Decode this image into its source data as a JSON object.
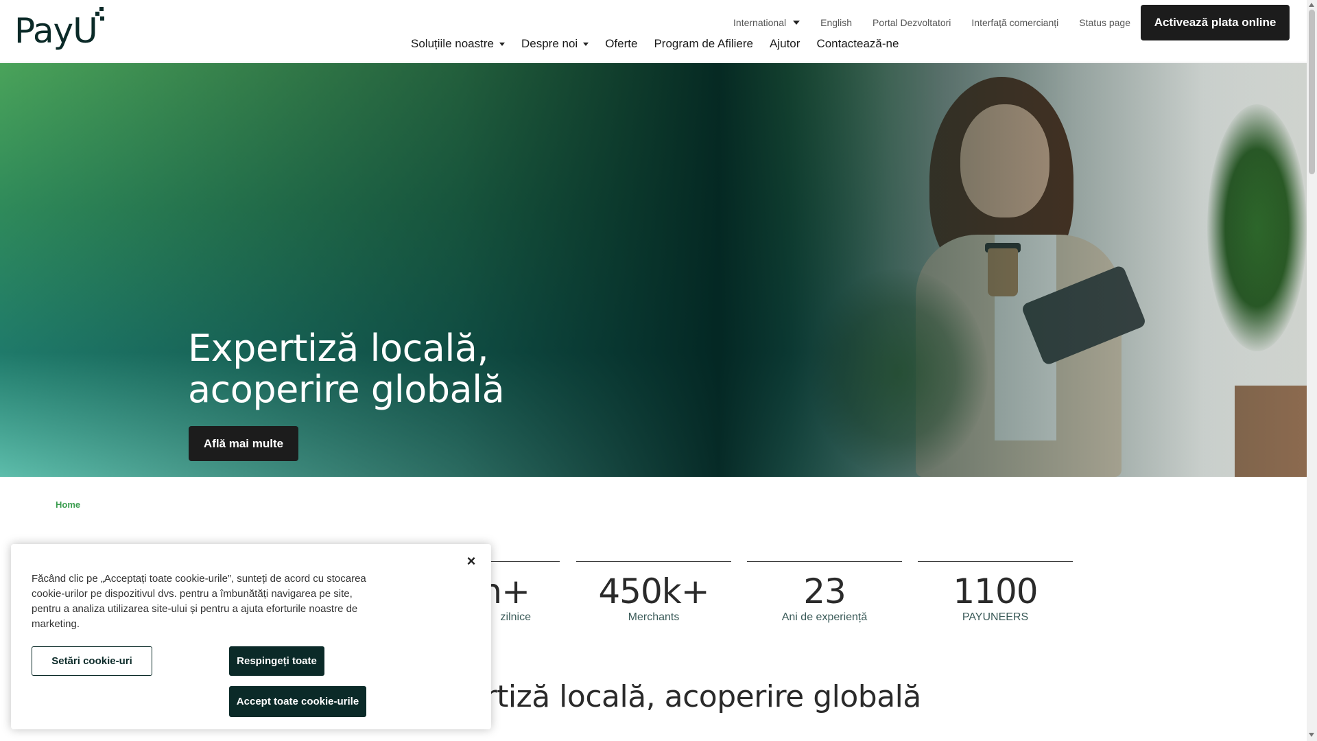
{
  "header": {
    "logo_text": "PayU",
    "top_links": {
      "international": "International",
      "english": "English",
      "developer_portal": "Portal Dezvoltatori",
      "merchant_panel": "Interfață comercianți",
      "status_page": "Status page"
    },
    "cta": "Activează plata online",
    "main_nav": {
      "solutions": "Soluțiile noastre",
      "about": "Despre noi",
      "offers": "Oferte",
      "affiliate": "Program de Afiliere",
      "help": "Ajutor",
      "contact": "Contactează-ne"
    }
  },
  "hero": {
    "title_line1": "Expertiză locală,",
    "title_line2": "acoperire globală",
    "button": "Află mai multe"
  },
  "breadcrumb": "Home",
  "stats": [
    {
      "value": "n+",
      "label": "zilnice"
    },
    {
      "value": "450k+",
      "label": "Merchants"
    },
    {
      "value": "23",
      "label": "Ani de experiență"
    },
    {
      "value": "1100",
      "label": "PAYUNEERS"
    }
  ],
  "section_title": "ertiză locală, acoperire globală",
  "cookie_banner": {
    "text": "Făcând clic pe „Acceptați toate cookie-urile”, sunteți de acord cu stocarea cookie-urilor pe dispozitivul dvs. pentru a îmbunătăți navigarea pe site, pentru a analiza utilizarea site-ului și pentru a ajuta eforturile noastre de marketing.",
    "close": "×",
    "settings_button": "Setări cookie-uri",
    "reject_button": "Respingeți toate",
    "accept_button": "Accept toate cookie-urile"
  },
  "colors": {
    "brand_dark": "#0b2a28",
    "brand_green": "#3a9d4e",
    "button_dark": "#1c1c1c"
  }
}
